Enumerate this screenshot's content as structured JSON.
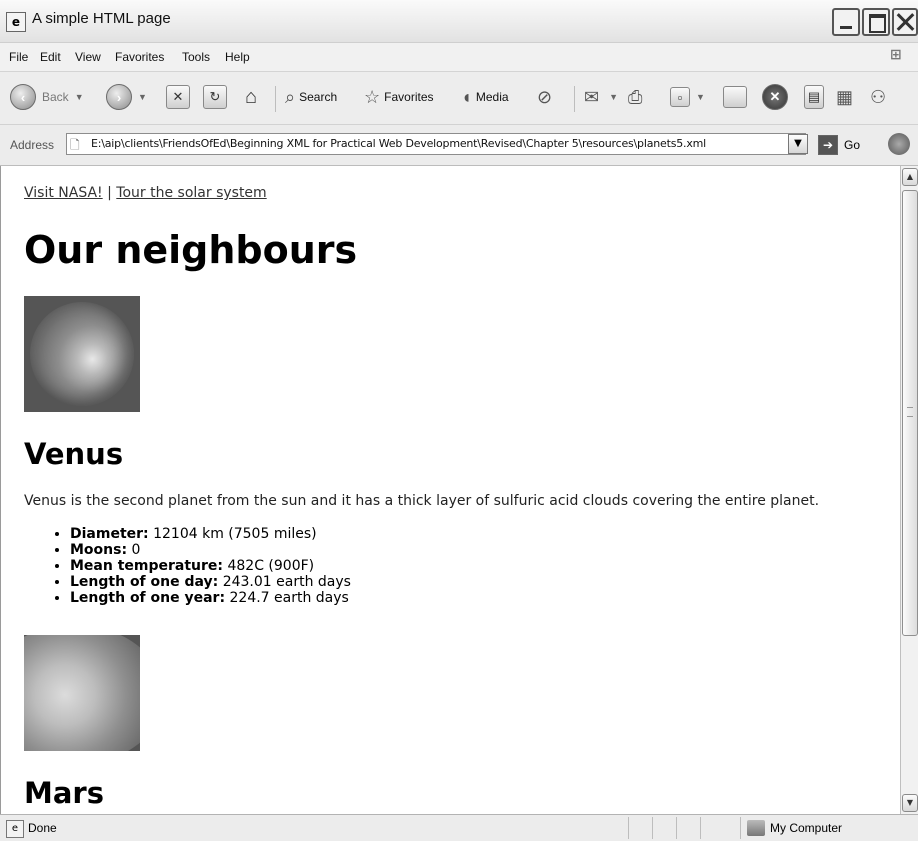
{
  "window": {
    "title": "A simple HTML page"
  },
  "menu": [
    "File",
    "Edit",
    "View",
    "Favorites",
    "Tools",
    "Help"
  ],
  "toolbar": {
    "back": "Back",
    "search": "Search",
    "favorites": "Favorites",
    "media": "Media"
  },
  "address": {
    "label": "Address",
    "value": "E:\\aip\\clients\\FriendsOfEd\\Beginning XML for Practical Web Development\\Revised\\Chapter 5\\resources\\planets5.xml",
    "go": "Go"
  },
  "page": {
    "links": {
      "nasa": "Visit NASA!",
      "separator": "|",
      "tour": "Tour the solar system"
    },
    "heading": "Our neighbours",
    "venus": {
      "name": "Venus",
      "description": "Venus is the second planet from the sun and it has a thick layer of sulfuric acid clouds covering the entire planet.",
      "facts": [
        {
          "label": "Diameter:",
          "value": "12104 km (7505 miles)"
        },
        {
          "label": "Moons:",
          "value": "0"
        },
        {
          "label": "Mean temperature:",
          "value": "482C (900F)"
        },
        {
          "label": "Length of one day:",
          "value": "243.01 earth days"
        },
        {
          "label": "Length of one year:",
          "value": "224.7 earth days"
        }
      ]
    },
    "mars": {
      "name": "Mars"
    }
  },
  "status": {
    "text": "Done",
    "zone": "My Computer"
  }
}
